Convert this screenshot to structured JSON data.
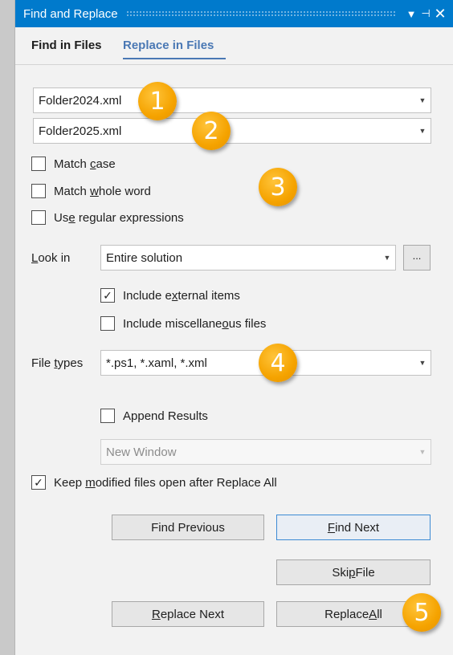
{
  "window": {
    "title": "Find and Replace",
    "dropdown_glyph": "▼",
    "pin_glyph": "⊣",
    "close_glyph": "✕"
  },
  "tabs": [
    {
      "label": "Find in Files",
      "active": false
    },
    {
      "label": "Replace in Files",
      "active": true
    }
  ],
  "find": {
    "value": "Folder2024.xml"
  },
  "replace": {
    "value": "Folder2025.xml"
  },
  "options": {
    "match_case": {
      "pre": "Match ",
      "u": "c",
      "post": "ase",
      "checked": false
    },
    "match_whole_word": {
      "pre": "Match ",
      "u": "w",
      "post": "hole word",
      "checked": false
    },
    "use_regex": {
      "pre": "Us",
      "u": "e",
      "post": " regular expressions",
      "checked": false
    }
  },
  "look_in": {
    "label_u": "L",
    "label_rest": "ook in",
    "value": "Entire solution",
    "browse_label": "..."
  },
  "include_external": {
    "pre": "Include e",
    "u": "x",
    "post": "ternal items",
    "checked": true
  },
  "include_misc": {
    "pre": "Include miscellane",
    "u": "o",
    "post": "us files",
    "checked": false
  },
  "file_types": {
    "label_pre": "File ",
    "label_u": "t",
    "label_post": "ypes",
    "value": "*.ps1, *.xaml, *.xml"
  },
  "append_results": {
    "label": "Append Results",
    "checked": false
  },
  "results_window": {
    "value": "New Window",
    "disabled": true
  },
  "keep_open": {
    "pre": "Keep ",
    "u": "m",
    "post": "odified files open after Replace All",
    "checked": true
  },
  "buttons": {
    "find_previous": "Find Previous",
    "find_next_u": "F",
    "find_next_rest": "ind Next",
    "skip_pre": "Ski",
    "skip_u": "p",
    "skip_post": " File",
    "replace_next_u": "R",
    "replace_next_rest": "eplace Next",
    "replace_all_pre": "Replace ",
    "replace_all_u": "A",
    "replace_all_post": "ll"
  },
  "check_glyph": "✓",
  "callouts": [
    "1",
    "2",
    "3",
    "4",
    "5"
  ],
  "colors": {
    "titlebar": "#007acc",
    "accent_tab": "#4a78b4",
    "callout": "#f5a300"
  }
}
